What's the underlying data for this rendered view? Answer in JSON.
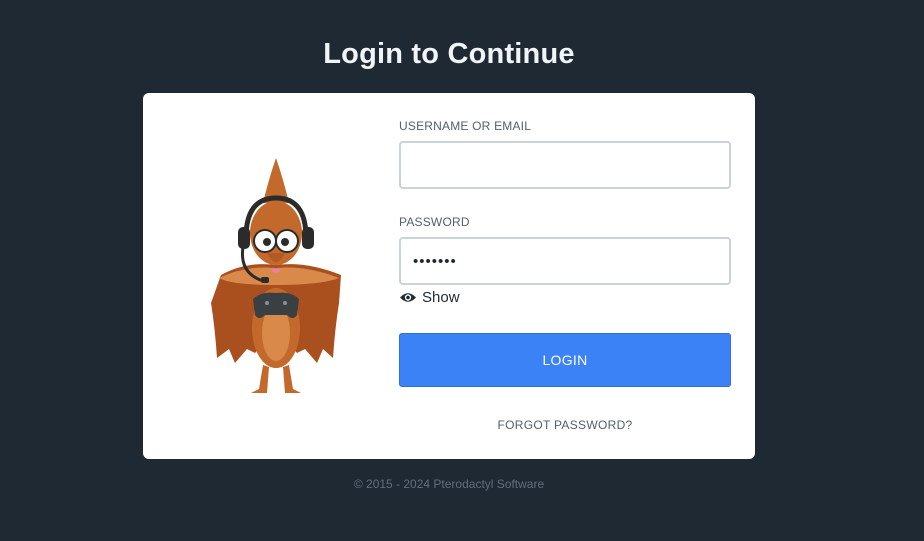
{
  "page": {
    "title": "Login to Continue"
  },
  "form": {
    "username_label": "USERNAME OR EMAIL",
    "username_value": "",
    "password_label": "PASSWORD",
    "password_value": "•••••••",
    "show_label": "Show",
    "login_label": "LOGIN",
    "forgot_label": "FORGOT PASSWORD?"
  },
  "footer": {
    "text": "© 2015 - 2024 Pterodactyl Software"
  },
  "icons": {
    "eye": "eye-icon",
    "mascot": "pterodactyl-mascot"
  },
  "colors": {
    "background": "#1f2933",
    "card": "#ffffff",
    "accent": "#3b82f6",
    "mascot_body": "#c4692c"
  }
}
